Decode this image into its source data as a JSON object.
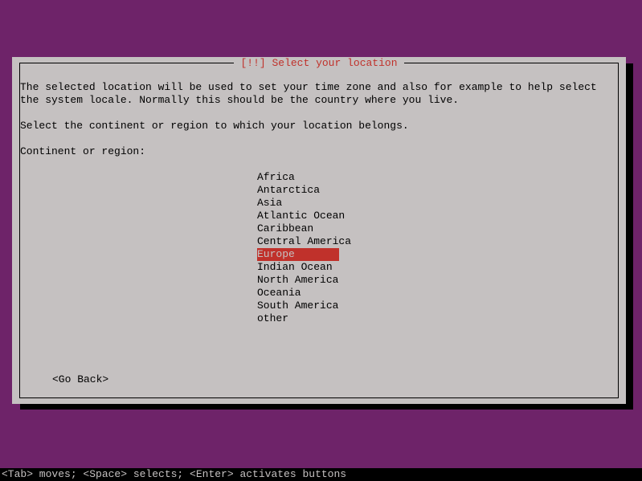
{
  "dialog": {
    "title": "[!!] Select your location",
    "paragraph1": "The selected location will be used to set your time zone and also for example to help select the system locale. Normally this should be the country where you live.",
    "paragraph2": "Select the continent or region to which your location belongs.",
    "listLabel": "Continent or region:",
    "items": [
      {
        "label": "Africa",
        "selected": false
      },
      {
        "label": "Antarctica",
        "selected": false
      },
      {
        "label": "Asia",
        "selected": false
      },
      {
        "label": "Atlantic Ocean",
        "selected": false
      },
      {
        "label": "Caribbean",
        "selected": false
      },
      {
        "label": "Central America",
        "selected": false
      },
      {
        "label": "Europe",
        "selected": true
      },
      {
        "label": "Indian Ocean",
        "selected": false
      },
      {
        "label": "North America",
        "selected": false
      },
      {
        "label": "Oceania",
        "selected": false
      },
      {
        "label": "South America",
        "selected": false
      },
      {
        "label": "other",
        "selected": false
      }
    ],
    "goBack": "<Go Back>"
  },
  "statusbar": "<Tab> moves; <Space> selects; <Enter> activates buttons"
}
